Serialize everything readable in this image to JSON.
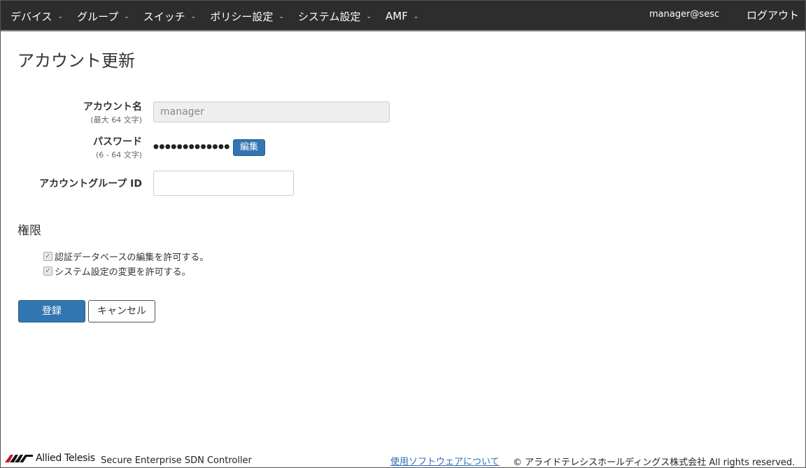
{
  "navbar": {
    "menu": [
      {
        "label": "デバイス"
      },
      {
        "label": "グループ"
      },
      {
        "label": "スイッチ"
      },
      {
        "label": "ポリシー設定"
      },
      {
        "label": "システム設定"
      },
      {
        "label": "AMF"
      }
    ],
    "user": "manager@sesc",
    "logout": "ログアウト"
  },
  "page": {
    "title": "アカウント更新"
  },
  "form": {
    "account_name": {
      "label": "アカウント名",
      "hint": "(最大 64 文字)",
      "value": "manager"
    },
    "password": {
      "label": "パスワード",
      "hint": "(6 - 64 文字)",
      "masked": "●●●●●●●●●●●●●",
      "edit_label": "編集"
    },
    "group_id": {
      "label": "アカウントグループ ID",
      "value": ""
    }
  },
  "permissions": {
    "title": "権限",
    "items": [
      {
        "label": "認証データベースの編集を許可する。",
        "checked": true
      },
      {
        "label": "システム設定の変更を許可する。",
        "checked": true
      }
    ]
  },
  "actions": {
    "submit": "登録",
    "cancel": "キャンセル"
  },
  "footer": {
    "brand": "Allied Telesis",
    "product": "Secure Enterprise SDN Controller",
    "link": "使用ソフトウェアについて",
    "copyright": "© アライドテレシスホールディングス株式会社 All rights reserved."
  },
  "colors": {
    "navbar_bg": "#2d2d2d",
    "primary": "#3276b1",
    "link": "#2a6ebb"
  }
}
